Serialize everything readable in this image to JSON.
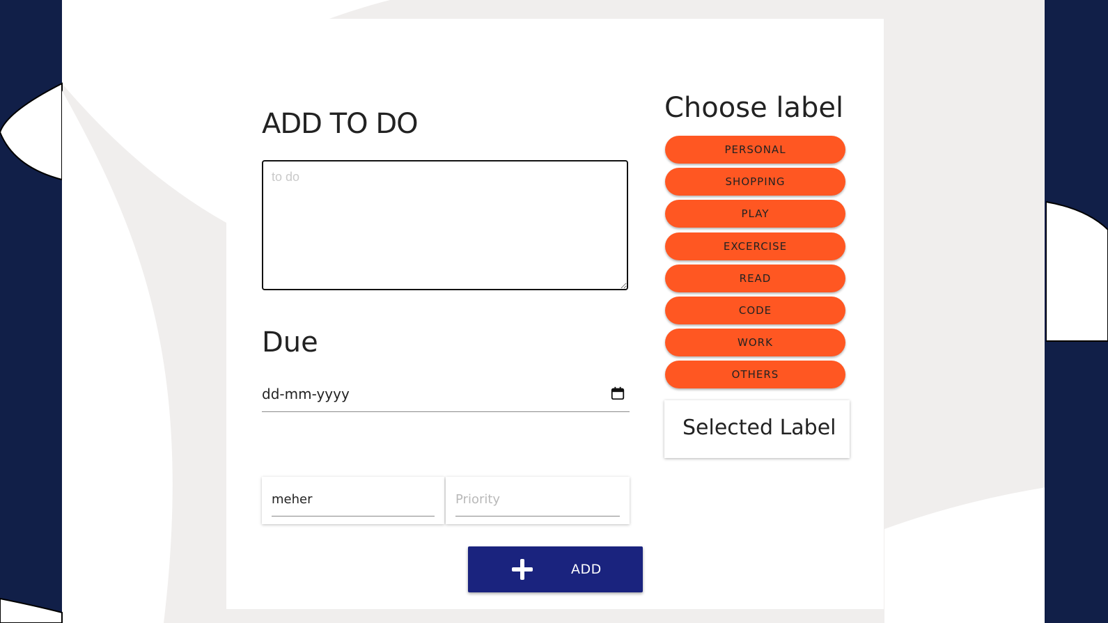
{
  "form": {
    "title": "ADD TO DO",
    "todo_placeholder": "to do",
    "due_heading": "Due",
    "date_value": "dd-mm-yyyy",
    "name_value": "meher",
    "priority_placeholder": "Priority",
    "add_label": "ADD"
  },
  "labels": {
    "heading": "Choose label",
    "items": [
      "PERSONAL",
      "SHOPPING",
      "PLAY",
      "EXCERCISE",
      "READ",
      "CODE",
      "WORK",
      "OTHERS"
    ],
    "selected_text": "Selected Label"
  },
  "colors": {
    "background_navy": "#111f48",
    "label_orange": "#ff5722",
    "add_button_indigo": "#1a237e"
  }
}
